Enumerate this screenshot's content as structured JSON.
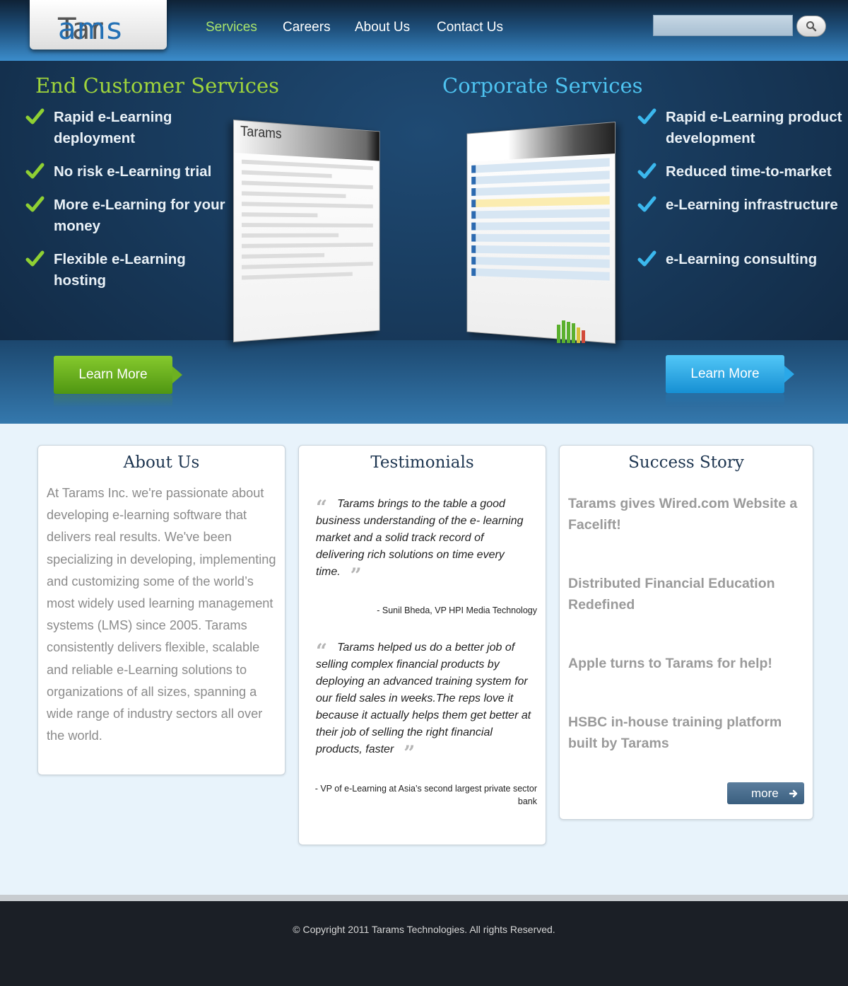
{
  "header": {
    "logo_part1": "Tar",
    "logo_part2": "ams",
    "nav": [
      "Services",
      "Careers",
      "About Us",
      "Contact Us"
    ],
    "active_nav": "Services",
    "search": {
      "placeholder": ""
    },
    "search_icon": "magnifier-icon"
  },
  "hero": {
    "left_title": "End Customer Services",
    "right_title": "Corporate Services",
    "left_features": [
      "Rapid e-Learning deployment",
      "No risk e-Learning trial",
      "More e-Learning for your money",
      "Flexible e-Learning hosting"
    ],
    "right_features": [
      "Rapid e-Learning product development",
      "Reduced time-to-market",
      "e-Learning infrastructure",
      "e-Learning consulting"
    ],
    "left_button": "Learn More",
    "right_button": "Learn More",
    "left_screenshot_logo": "Tarams",
    "colors": {
      "green": "#9fd43c",
      "blue": "#4ec3f0"
    }
  },
  "about": {
    "title": "About Us",
    "text": "At Tarams Inc. we're passionate about developing e-learning software that delivers real results. We've been specializing in developing, implementing and customizing some of the world’s most widely used learning management systems (LMS) since 2005. Tarams consistently delivers flexible, scalable and reliable e-Learning solutions to organizations of all sizes, spanning a wide range of industry sectors all over the world."
  },
  "testimonials": {
    "title": "Testimonials",
    "items": [
      {
        "quote": "Tarams brings to the table a good business understanding of the e- learning market and a solid track record of delivering rich solutions on time every time.",
        "author": "- Sunil Bheda, VP HPI Media Technology"
      },
      {
        "quote": "Tarams helped us do a better job of selling complex financial products by deploying an advanced training system for our field sales in weeks.The reps love it because it actually helps them get better at their job of selling the right financial products, faster",
        "author": "- VP of e-Learning at Asia’s second largest private sector bank"
      }
    ]
  },
  "success": {
    "title": "Success Story",
    "items": [
      "Tarams gives Wired.com Website a Facelift!",
      "Distributed Financial Education Redefined",
      "Apple turns to Tarams for help!",
      "HSBC in-house training platform built by Tarams"
    ],
    "more_label": "more"
  },
  "footer": {
    "copyright": "© Copyright 2011 Tarams Technologies. All rights Reserved."
  }
}
